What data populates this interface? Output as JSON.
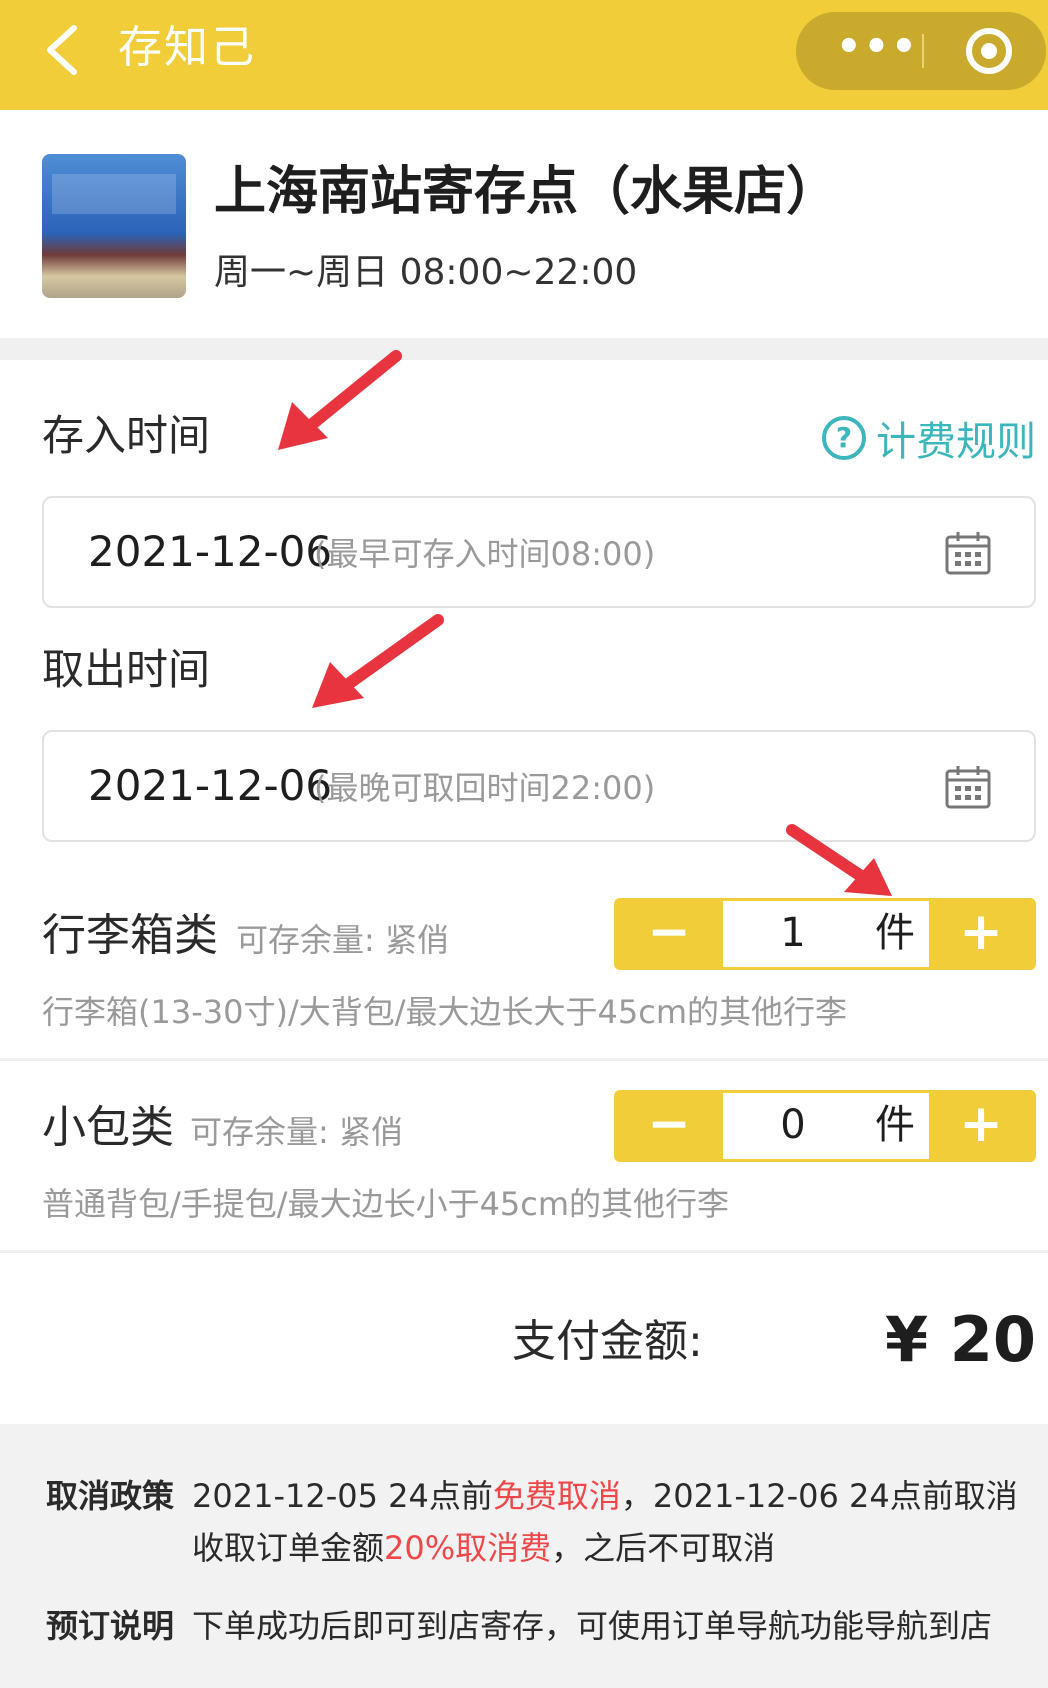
{
  "header": {
    "back_icon": "chevron-left-icon",
    "title": "存知己",
    "more_icon": "more-dots-icon",
    "close_icon": "target-circle-icon"
  },
  "store": {
    "name": "上海南站寄存点（水果店）",
    "hours": "周一~周日 08:00~22:00"
  },
  "deposit": {
    "label": "存入时间",
    "date": "2021-12-06",
    "hint": "(最早可存入时间08:00)"
  },
  "rules_link": {
    "icon": "help-circle-icon",
    "label": "计费规则"
  },
  "pickup": {
    "label": "取出时间",
    "date": "2021-12-06",
    "hint": "(最晚可取回时间22:00)"
  },
  "luggage": [
    {
      "title": "行李箱类",
      "availability": "可存余量: 紧俏",
      "description": "行李箱(13-30寸)/大背包/最大边长大于45cm的其他行李",
      "count": "1",
      "unit": "件",
      "minus": "−",
      "plus": "+"
    },
    {
      "title": "小包类",
      "availability": "可存余量: 紧俏",
      "description": "普通背包/手提包/最大边长小于45cm的其他行李",
      "count": "0",
      "unit": "件",
      "minus": "−",
      "plus": "+"
    }
  ],
  "payment": {
    "label": "支付金额:",
    "amount": "¥ 20"
  },
  "policy": {
    "cancel_label": "取消政策",
    "cancel_part1": "2021-12-05 24点前",
    "cancel_free": "免费取消",
    "cancel_part2": "，2021-12-06 24点前取消收取订单金额",
    "cancel_fee": "20%取消费",
    "cancel_part3": "，之后不可取消",
    "booking_label": "预订说明",
    "booking_text": "下单成功后即可到店寄存，可使用订单导航功能导航到店"
  },
  "colors": {
    "accent_yellow": "#f2cd3a",
    "link_teal": "#3bb6bd",
    "warning_red": "#f0474a",
    "annotation_arrow": "#e8343f"
  }
}
